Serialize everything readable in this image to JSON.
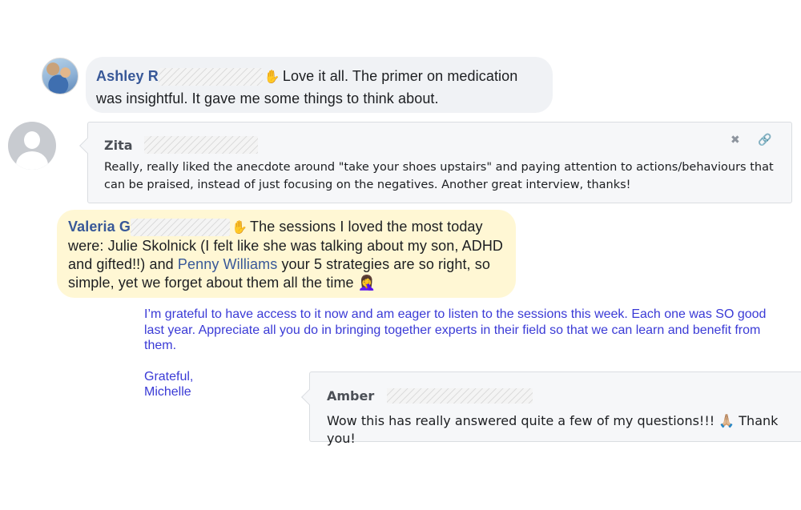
{
  "comments": {
    "ashley": {
      "author": "Ashley R",
      "wave_icon": "waving-hand-icon",
      "text": "Love it all. The primer on medication was insightful. It gave me some things to think about."
    },
    "zita": {
      "author": "Zita",
      "text": "Really, really liked the anecdote around \"take your shoes upstairs\" and paying attention to actions/behaviours that can be praised, instead of just focusing on the negatives. Another great interview, thanks!",
      "close_icon": "close-icon",
      "link_icon": "link-icon"
    },
    "valeria": {
      "author": "Valeria G",
      "text_before_mention": "The sessions I loved the most today were: Julie Skolnick (I felt like she was talking about my son, ADHD and gifted!!) and ",
      "mention": "Penny Williams",
      "text_after_mention": " your 5 strategies are so right, so simple, yet we forget about them all the time",
      "end_emoji": "🤦‍♀️"
    },
    "email": {
      "body": "I’m grateful to have access to it now and am eager to listen to the sessions this week. Each one was SO good last year. Appreciate all you do in bringing together experts in their field so that we can learn and benefit from them.",
      "closing": "Grateful,",
      "signature": "Michelle"
    },
    "amber": {
      "author": "Amber",
      "text": "Wow this has really answered quite a few of my questions!!!",
      "emoji": "🙏🏼",
      "text_end": "Thank you!"
    }
  },
  "colors": {
    "author_blue": "#385898",
    "email_blue": "#3a3ad6",
    "bubble_gray": "#f0f2f5",
    "bubble_yellow": "#fff7d4"
  }
}
